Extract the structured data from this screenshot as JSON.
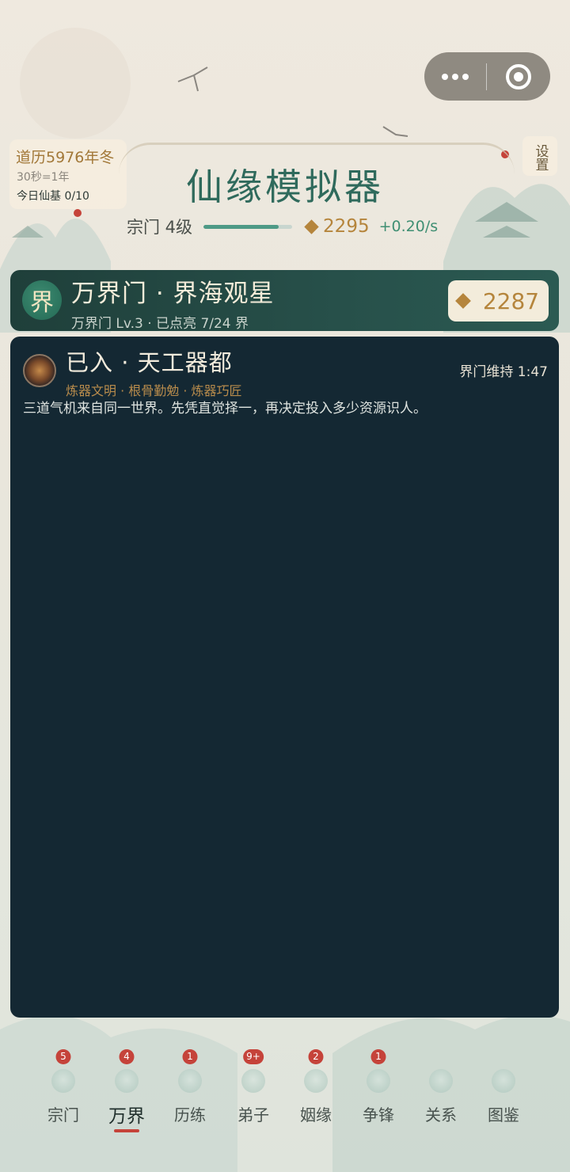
{
  "calendar": {
    "year_label": "道历5976年冬",
    "time_rate": "30秒=1年",
    "daily_foundation": "今日仙基 0/10"
  },
  "settings_label": "设置",
  "app_title": "仙缘模拟器",
  "sect": {
    "level_label": "宗门 4级",
    "level_progress": 0.85,
    "spirit_stones": "2295",
    "income_rate": "+0.20/s"
  },
  "realm": {
    "badge": "界",
    "name": "万界门 · 界海观星",
    "subtitle": "万界门 Lv.3 · 已点亮 7/24 界",
    "coins": "2287"
  },
  "world": {
    "title": "已入 · 天工器都",
    "timer": "界门维持 1:47",
    "tags": "炼器文明 · 根骨勤勉 · 炼器巧匠",
    "description": "三道气机来自同一世界。先凭直觉择一，再决定投入多少资源识人。"
  },
  "tabs": [
    {
      "label": "宗门",
      "badge": "5",
      "icon": "sect-hall-icon"
    },
    {
      "label": "万界",
      "badge": "4",
      "icon": "realm-gate-icon"
    },
    {
      "label": "历练",
      "badge": "1",
      "icon": "trial-icon"
    },
    {
      "label": "弟子",
      "badge": "9+",
      "icon": "disciple-icon"
    },
    {
      "label": "姻缘",
      "badge": "2",
      "icon": "marriage-icon"
    },
    {
      "label": "争锋",
      "badge": "1",
      "icon": "battle-icon"
    },
    {
      "label": "关系",
      "badge": "",
      "icon": "relation-icon"
    },
    {
      "label": "图鉴",
      "badge": "",
      "icon": "codex-icon"
    }
  ],
  "colors": {
    "accent_green": "#2f6a5c",
    "gold": "#b5853c",
    "card_dark": "#142833",
    "badge_red": "#c5433a"
  }
}
